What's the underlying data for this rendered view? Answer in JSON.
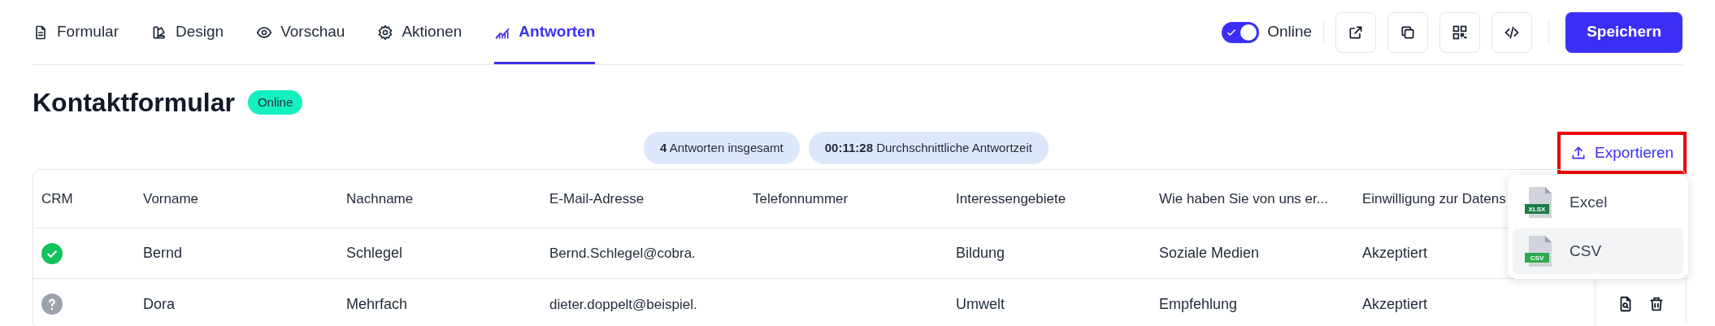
{
  "tabs": [
    {
      "label": "Formular",
      "selected": false
    },
    {
      "label": "Design",
      "selected": false
    },
    {
      "label": "Vorschau",
      "selected": false
    },
    {
      "label": "Aktionen",
      "selected": false
    },
    {
      "label": "Antworten",
      "selected": true
    }
  ],
  "toolbar": {
    "online_toggle": {
      "label": "Online",
      "on": true
    },
    "save_button": "Speichern"
  },
  "form": {
    "title": "Kontaktformular",
    "status_badge": "Online"
  },
  "stats": [
    {
      "value": "4",
      "label": "Antworten insgesamt"
    },
    {
      "value": "00:11:28",
      "label": "Durchschnittliche Antwortzeit"
    }
  ],
  "export_button": {
    "label": "Exportieren",
    "highlighted": true
  },
  "export_menu": [
    {
      "label": "Excel",
      "file_tag": "XLSX",
      "selected": false
    },
    {
      "label": "CSV",
      "file_tag": "CSV",
      "selected": true
    }
  ],
  "table": {
    "columns": [
      "CRM",
      "Vorname",
      "Nachname",
      "E-Mail-Adresse",
      "Telefonnummer",
      "Interessengebiete",
      "Wie haben Sie von uns er...",
      "Einwilligung zur Datens"
    ],
    "rows": [
      {
        "crm_synced": true,
        "cells": [
          "",
          "Bernd",
          "Schlegel",
          "Bernd.Schlegel@cobra.",
          "",
          "Bildung",
          "Soziale Medien",
          "Akzeptiert"
        ],
        "actions_visible": false
      },
      {
        "crm_synced": false,
        "cells": [
          "",
          "Dora",
          "Mehrfach",
          "dieter.doppelt@beispiel.",
          "",
          "Umwelt",
          "Empfehlung",
          "Akzeptiert"
        ],
        "actions_visible": true
      }
    ]
  }
}
